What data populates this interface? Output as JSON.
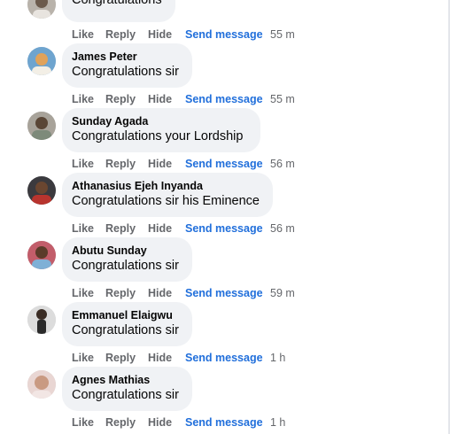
{
  "actions": {
    "like": "Like",
    "reply": "Reply",
    "hide": "Hide",
    "send": "Send message"
  },
  "comments": [
    {
      "author": "",
      "text": "Congratulations",
      "time": "55 m",
      "avatar": "partial-avatar"
    },
    {
      "author": "James Peter",
      "text": "Congratulations sir",
      "time": "55 m",
      "avatar": "user-avatar"
    },
    {
      "author": "Sunday Agada",
      "text": "Congratulations your Lordship",
      "time": "56 m",
      "avatar": "user-avatar"
    },
    {
      "author": "Athanasius Ejeh Inyanda",
      "text": "Congratulations sir his Eminence",
      "time": "56 m",
      "avatar": "user-avatar"
    },
    {
      "author": "Abutu Sunday",
      "text": "Congratulations sir",
      "time": "59 m",
      "avatar": "user-avatar"
    },
    {
      "author": "Emmanuel Elaigwu",
      "text": "Congratulations sir",
      "time": "1 h",
      "avatar": "user-avatar"
    },
    {
      "author": "Agnes Mathias",
      "text": "Congratulations sir",
      "time": "1 h",
      "avatar": "user-avatar"
    }
  ]
}
